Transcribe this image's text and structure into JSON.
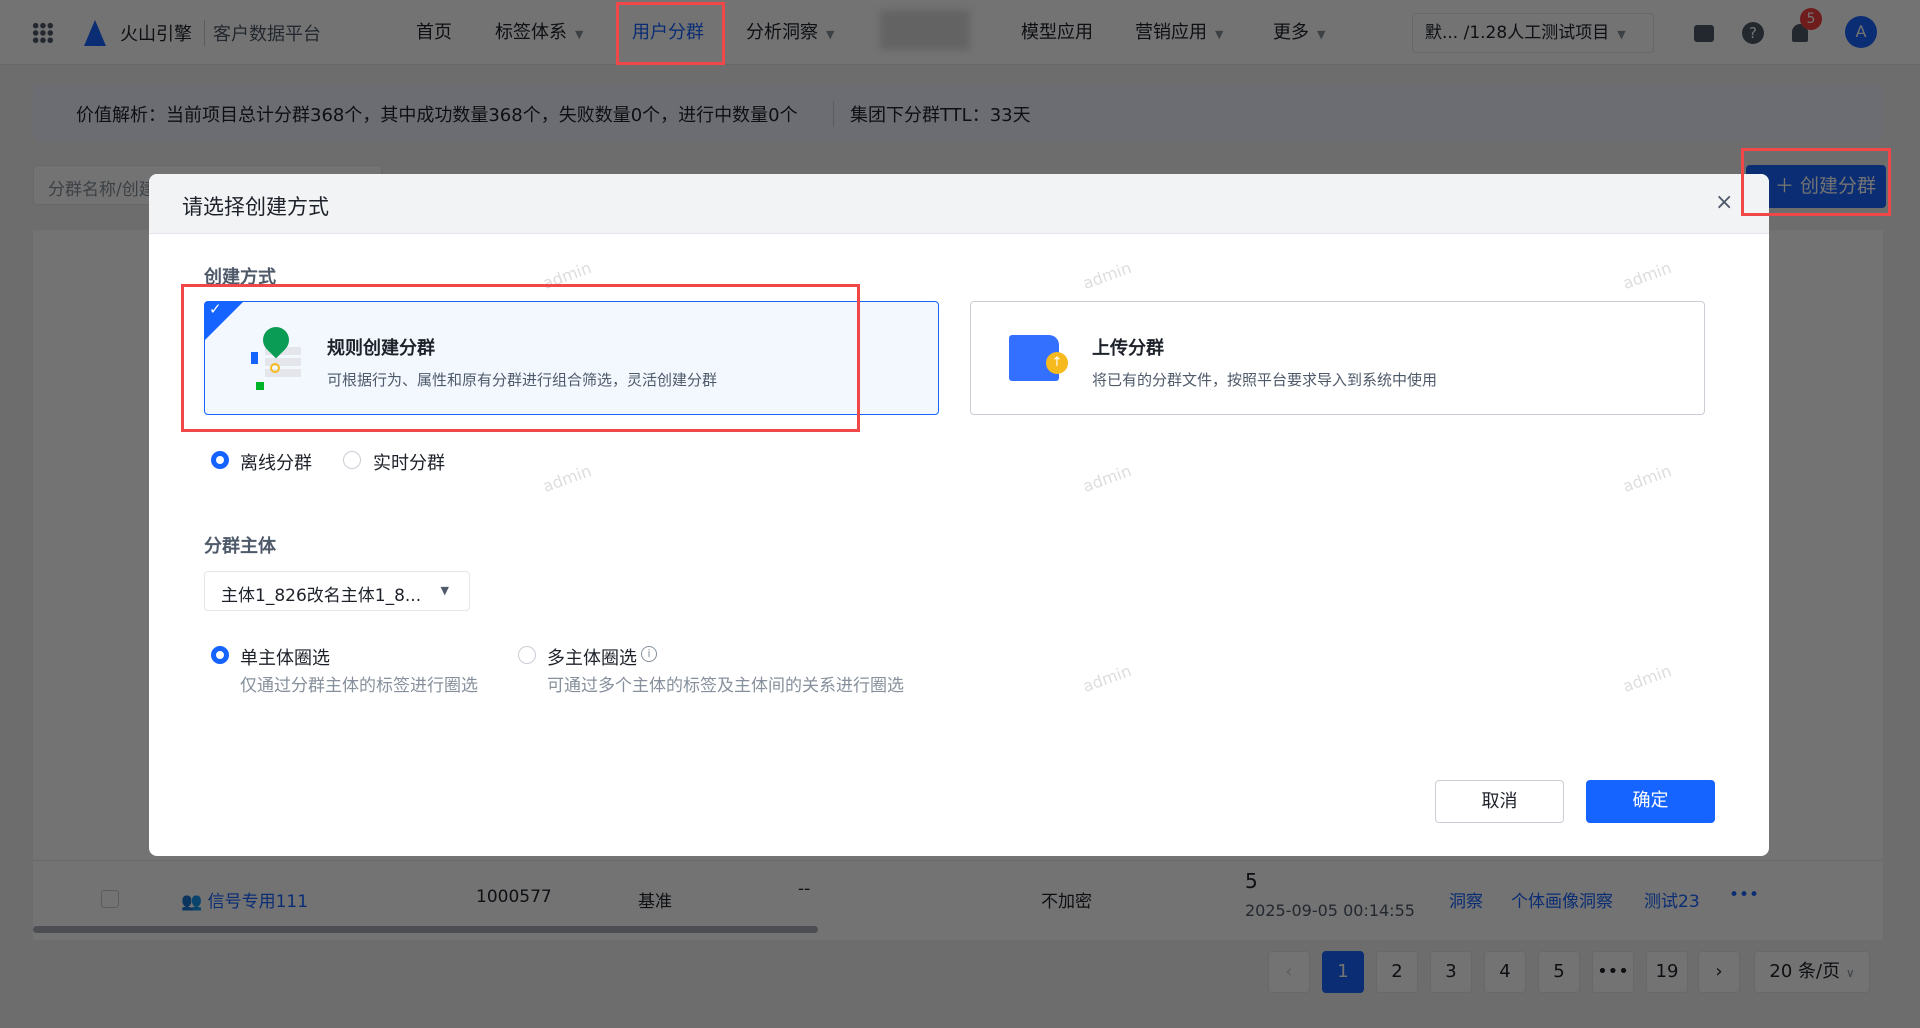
{
  "topbar": {
    "logo": "火山引擎",
    "product": "客户数据平台",
    "nav": [
      {
        "label": "首页"
      },
      {
        "label": "标签体系"
      },
      {
        "label": "用户分群",
        "active": true
      },
      {
        "label": "分析洞察"
      },
      {
        "label": "模型应用"
      },
      {
        "label": "营销应用"
      },
      {
        "label": "更多"
      }
    ],
    "project": "默... /1.28人工测试项目",
    "notification_count": "5",
    "avatar": "A"
  },
  "banner": {
    "text": "价值解析：当前项目总计分群368个，其中成功数量368个，失败数量0个，进行中数量0个",
    "ttl": "集团下分群TTL：33天"
  },
  "toolbar": {
    "search_placeholder": "分群名称/创建",
    "create_button": "创建分群"
  },
  "table": {
    "last_row": {
      "name": "信号专用111",
      "id": "1000577",
      "type": "基准",
      "dash": "--",
      "encrypt": "不加密",
      "count": "5",
      "time": "2025-09-05 00:14:55",
      "actions": [
        "洞察",
        "个体画像洞察",
        "测试23"
      ]
    }
  },
  "pagination": {
    "pages": [
      "1",
      "2",
      "3",
      "4",
      "5",
      "•••",
      "19"
    ],
    "current": "1",
    "page_size": "20 条/页"
  },
  "modal": {
    "title": "请选择创建方式",
    "method_label": "创建方式",
    "cards": [
      {
        "title": "规则创建分群",
        "desc": "可根据行为、属性和原有分群进行组合筛选，灵活创建分群",
        "selected": true
      },
      {
        "title": "上传分群",
        "desc": "将已有的分群文件，按照平台要求导入到系统中使用",
        "selected": false
      }
    ],
    "mode_options": [
      {
        "label": "离线分群",
        "checked": true
      },
      {
        "label": "实时分群",
        "checked": false
      }
    ],
    "subject_label": "分群主体",
    "subject_value": "主体1_826改名主体1_8...",
    "scope_options": [
      {
        "label": "单主体圈选",
        "desc": "仅通过分群主体的标签进行圈选",
        "checked": true
      },
      {
        "label": "多主体圈选",
        "desc": "可通过多个主体的标签及主体间的关系进行圈选",
        "checked": false
      }
    ],
    "cancel": "取消",
    "ok": "确定"
  },
  "watermark": "admin",
  "colors": {
    "primary": "#1664ff",
    "highlight": "#f04848"
  }
}
